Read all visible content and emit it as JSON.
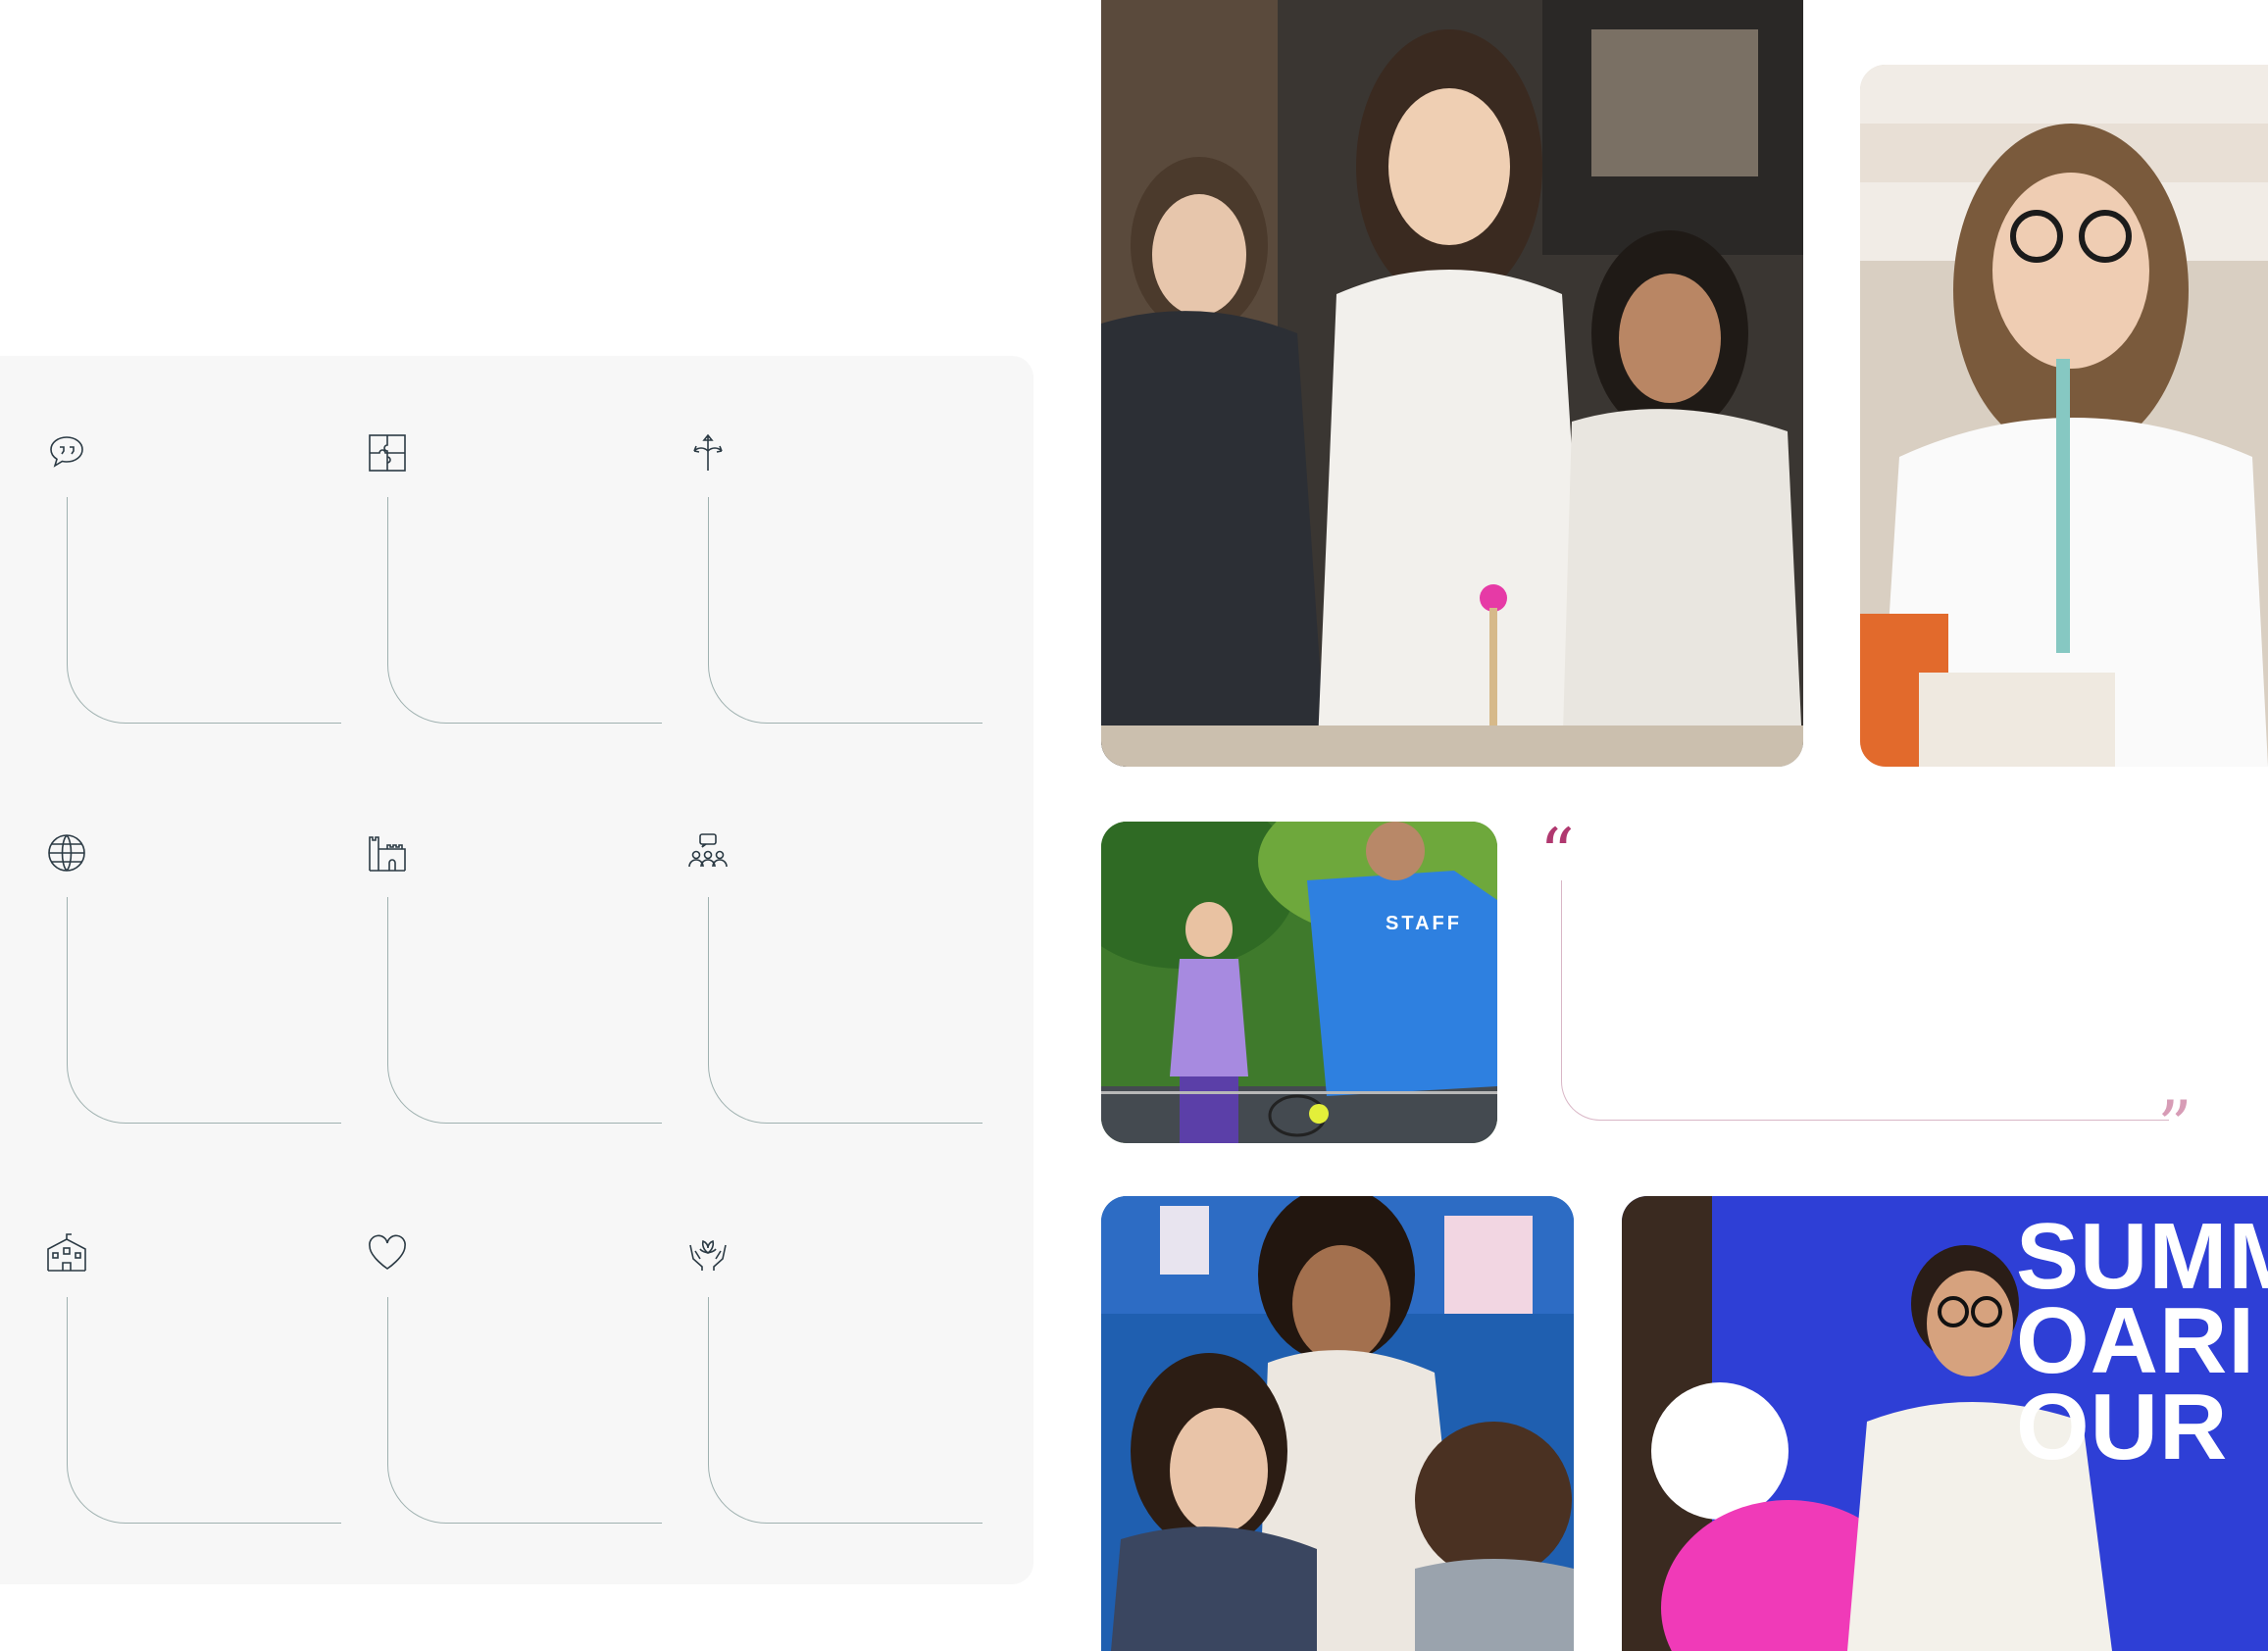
{
  "features": [
    {
      "icon": "speech-bubbles-icon",
      "title": ""
    },
    {
      "icon": "puzzle-icon",
      "title": ""
    },
    {
      "icon": "directions-arrows-icon",
      "title": ""
    },
    {
      "icon": "globe-icon",
      "title": ""
    },
    {
      "icon": "castle-icon",
      "title": ""
    },
    {
      "icon": "group-discussion-icon",
      "title": ""
    },
    {
      "icon": "school-building-icon",
      "title": ""
    },
    {
      "icon": "heart-icon",
      "title": ""
    },
    {
      "icon": "caring-hands-icon",
      "title": ""
    }
  ],
  "quote": {
    "open_mark": "“",
    "close_mark": "”",
    "text": ""
  },
  "photos": {
    "badminton_shirt_text": "STAFF",
    "stage_screen_lines": [
      "SUMM",
      "OARI",
      "OUR"
    ]
  },
  "colors": {
    "panel_bg": "#f7f7f7",
    "icon_stroke": "#2b3a44",
    "line": "#9fb1b0",
    "quote_accent": "#b0386f"
  }
}
